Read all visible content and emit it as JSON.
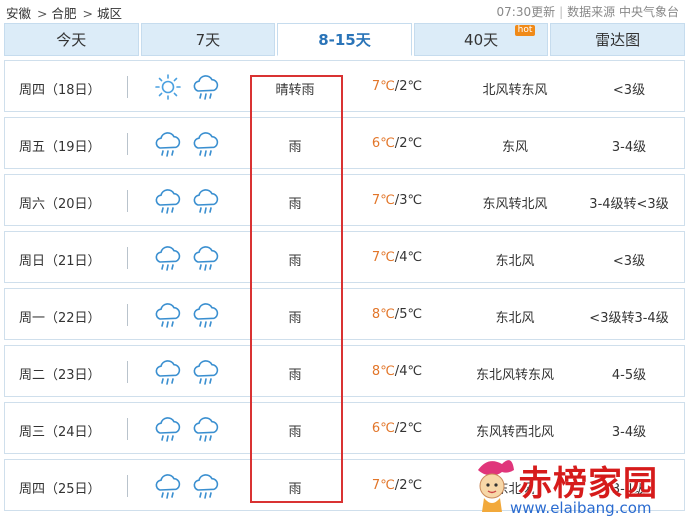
{
  "breadcrumb": [
    "安徽",
    "合肥",
    "城区"
  ],
  "breadcrumb_sep": ">",
  "update_time": "07:30更新",
  "source_label": "数据来源 中央气象台",
  "tabs": [
    {
      "label": "今天",
      "active": false
    },
    {
      "label": "7天",
      "active": false
    },
    {
      "label": "8-15天",
      "active": true
    },
    {
      "label": "40天",
      "active": false,
      "badge": "hot"
    },
    {
      "label": "雷达图",
      "active": false
    }
  ],
  "forecast": [
    {
      "day": "周四（18日）",
      "icons": [
        "sunny-icon",
        "rain-icon"
      ],
      "desc": "晴转雨",
      "high": "7℃",
      "low": "2℃",
      "wind": "北风转东风",
      "level": "<3级"
    },
    {
      "day": "周五（19日）",
      "icons": [
        "rain-icon",
        "rain-icon"
      ],
      "desc": "雨",
      "high": "6℃",
      "low": "2℃",
      "wind": "东风",
      "level": "3-4级"
    },
    {
      "day": "周六（20日）",
      "icons": [
        "rain-icon",
        "rain-icon"
      ],
      "desc": "雨",
      "high": "7℃",
      "low": "3℃",
      "wind": "东风转北风",
      "level": "3-4级转<3级"
    },
    {
      "day": "周日（21日）",
      "icons": [
        "rain-icon",
        "rain-icon"
      ],
      "desc": "雨",
      "high": "7℃",
      "low": "4℃",
      "wind": "东北风",
      "level": "<3级"
    },
    {
      "day": "周一（22日）",
      "icons": [
        "rain-icon",
        "rain-icon"
      ],
      "desc": "雨",
      "high": "8℃",
      "low": "5℃",
      "wind": "东北风",
      "level": "<3级转3-4级"
    },
    {
      "day": "周二（23日）",
      "icons": [
        "rain-icon",
        "rain-icon"
      ],
      "desc": "雨",
      "high": "8℃",
      "low": "4℃",
      "wind": "东北风转东风",
      "level": "4-5级"
    },
    {
      "day": "周三（24日）",
      "icons": [
        "rain-icon",
        "rain-icon"
      ],
      "desc": "雨",
      "high": "6℃",
      "low": "2℃",
      "wind": "东风转西北风",
      "level": "3-4级"
    },
    {
      "day": "周四（25日）",
      "icons": [
        "rain-icon",
        "rain-icon"
      ],
      "desc": "雨",
      "high": "7℃",
      "low": "2℃",
      "wind": "东北风",
      "level": "3-4级"
    }
  ],
  "watermark": {
    "brand": "赤榜家园",
    "url": "www.elaibang.com"
  },
  "colors": {
    "tab_bg": "#dcecf8",
    "tab_active_text": "#2a74b8",
    "high_temp": "#e2762a",
    "highlight_box": "#d93232",
    "icon_blue": "#3a8fd0",
    "sun_blue": "#4aa0e0"
  }
}
